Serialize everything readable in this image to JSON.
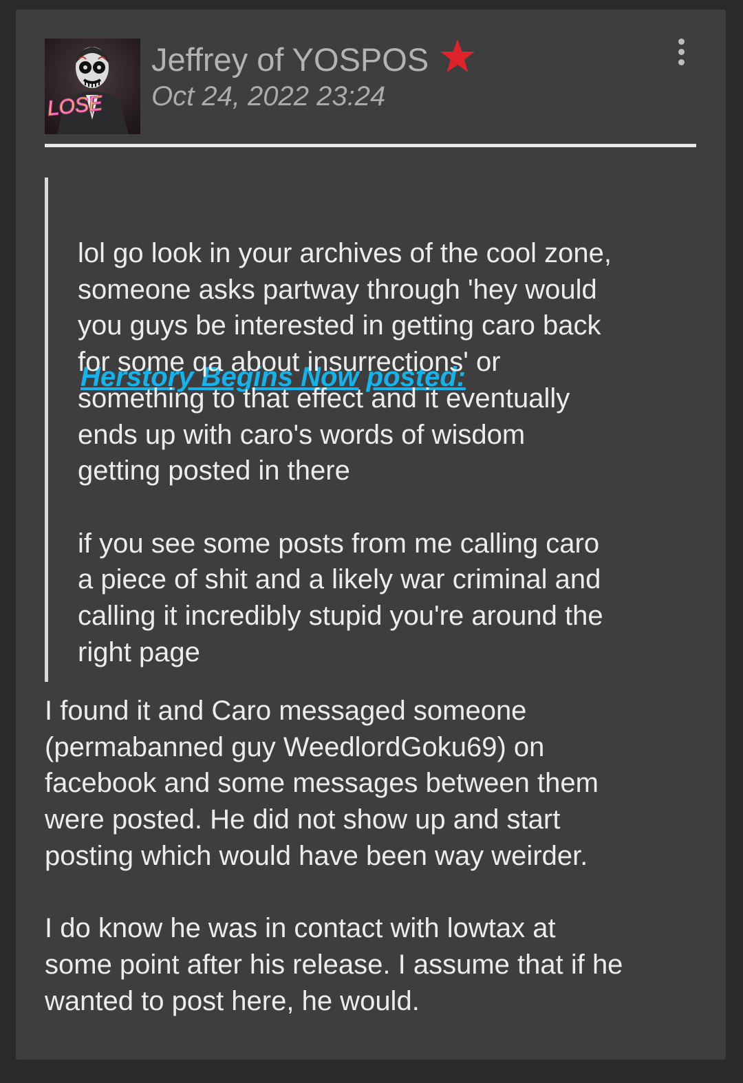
{
  "post": {
    "author": "Jeffrey of YOSPOS",
    "timestamp": "Oct 24, 2022 23:24",
    "avatar_text": "LOSE",
    "star_color": "#e0232b",
    "menu_icon": "vertical-dots-icon"
  },
  "quote": {
    "author_name": "Herstory Begins Now",
    "posted_label": "posted:",
    "paragraphs": [
      [
        "lol go look in your archives of the cool zone,",
        "someone asks partway through 'hey would",
        "you guys be interested in getting caro back",
        "for some qa about insurrections' or",
        "something to that effect and it eventually",
        "ends up with caro's words of wisdom",
        "getting posted in there"
      ],
      [
        "if you see some posts from me calling caro",
        "a piece of shit and a likely war criminal and",
        "calling it incredibly stupid you're around the",
        "right page"
      ]
    ]
  },
  "body": {
    "paragraphs": [
      [
        "I found it and Caro messaged someone",
        "(permabanned guy WeedlordGoku69) on",
        "facebook and some messages between them",
        "were posted. He did not show up and start",
        "posting which would have been way weirder."
      ],
      [
        "I do know he was in contact with lowtax at",
        "some point after his release. I assume that if he",
        "wanted to post here, he would."
      ]
    ]
  },
  "colors": {
    "page_background": "#2a2a2a",
    "card_background": "#3e3e3e",
    "link": "#14b3ec",
    "text": "#ececec",
    "muted_text": "#b3b3b3"
  }
}
